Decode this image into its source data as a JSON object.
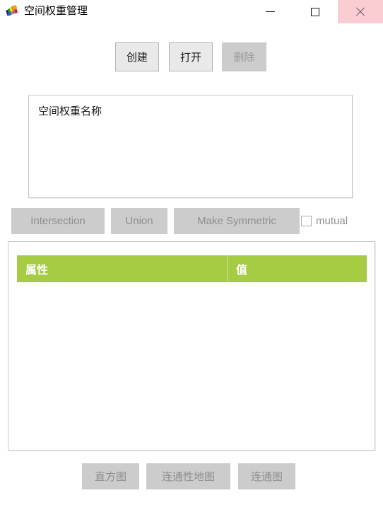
{
  "window": {
    "title": "空间权重管理",
    "icon": "geoda-weights-icon",
    "controls": {
      "minimize": "minimize-icon",
      "maximize": "maximize-icon",
      "close": "close-icon"
    },
    "close_button_highlight": "#f9cdd1"
  },
  "toolbar": {
    "create_label": "创建",
    "open_label": "打开",
    "delete_label": "删除"
  },
  "weights_list": {
    "column_header": "空间权重名称",
    "rows": []
  },
  "set_operations": {
    "intersection_label": "Intersection",
    "union_label": "Union",
    "make_symmetric_label": "Make Symmetric",
    "mutual_label": "mutual",
    "mutual_checked": false
  },
  "properties_table": {
    "header_color": "#a5cc42",
    "columns": [
      {
        "key": "attribute",
        "label": "属性"
      },
      {
        "key": "value",
        "label": "值"
      }
    ],
    "rows": []
  },
  "footer": {
    "histogram_label": "直方图",
    "connectivity_map_label": "连通性地图",
    "connectivity_graph_label": "连通图"
  }
}
